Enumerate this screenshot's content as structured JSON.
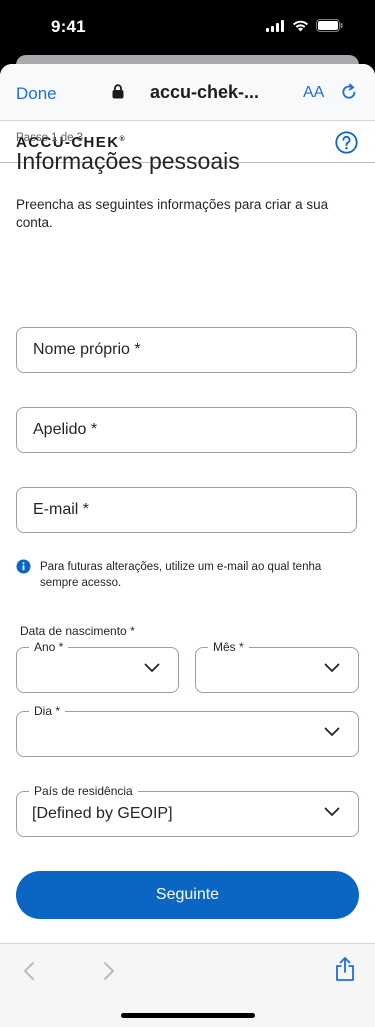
{
  "status": {
    "time": "9:41"
  },
  "browser": {
    "done_label": "Done",
    "url": "accu-chek-...",
    "text_size_label": "AA"
  },
  "brand": {
    "logo": "ACCU-CHEK",
    "logo_mark": "®"
  },
  "form": {
    "step": "Passo 1 de 3",
    "title": "Informações pessoais",
    "description": "Preencha as seguintes informações para criar a sua conta.",
    "first_name_placeholder": "Nome próprio *",
    "last_name_placeholder": "Apelido *",
    "email_placeholder": "E-mail *",
    "email_info": "Para futuras alterações, utilize um e-mail ao qual tenha sempre acesso.",
    "dob_label": "Data de nascimento *",
    "year_label": "Ano *",
    "month_label": "Mês *",
    "day_label": "Dia *",
    "country_label": "País de residência",
    "country_value": "[Defined by GEOIP]",
    "next_button": "Seguinte"
  },
  "colors": {
    "primary": "#0a66c2",
    "link": "#1f6ed8"
  }
}
